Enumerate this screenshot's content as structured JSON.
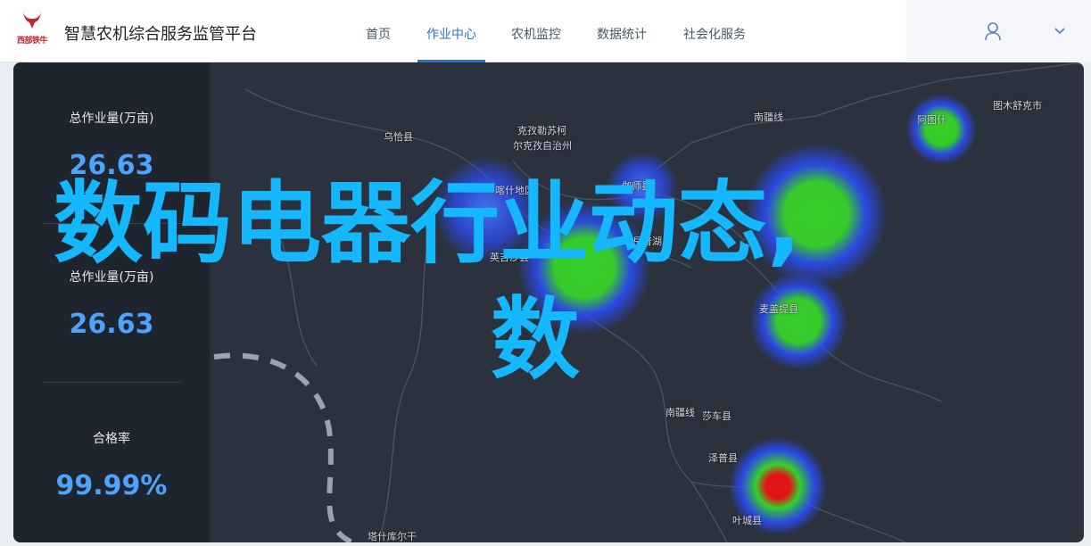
{
  "header": {
    "logo_text": "西部铁牛",
    "app_title": "智慧农机综合服务监管平台",
    "nav": [
      {
        "label": "首页",
        "active": false
      },
      {
        "label": "作业中心",
        "active": true
      },
      {
        "label": "农机监控",
        "active": false
      },
      {
        "label": "数据统计",
        "active": false
      },
      {
        "label": "社会化服务",
        "active": false
      }
    ]
  },
  "sidebar": {
    "stats": [
      {
        "label": "总作业量(万亩)",
        "value": "26.63"
      },
      {
        "label": "总作业量(万亩)",
        "value": "26.63"
      },
      {
        "label": "合格率",
        "value": "99.99%"
      }
    ]
  },
  "map": {
    "places": [
      "乌恰县",
      "克孜勒苏柯",
      "尔克孜自治州",
      "喀什地区",
      "伽师县",
      "岳普湖",
      "麦盖提县",
      "图木舒克市",
      "南疆线",
      "阿图什",
      "莎车县",
      "泽普县",
      "叶城县",
      "塔什库尔干",
      "南疆线",
      "英吉沙县"
    ],
    "heat_colors": {
      "low": "#2b4cff",
      "mid": "#36d12a",
      "high": "#e01515"
    }
  },
  "overlay": {
    "line1": "数码电器行业动态,",
    "line2": "数"
  },
  "colors": {
    "accent": "#2f6fd1",
    "stat_value": "#4ea3ff",
    "overlay_text": "#15b8ff"
  }
}
